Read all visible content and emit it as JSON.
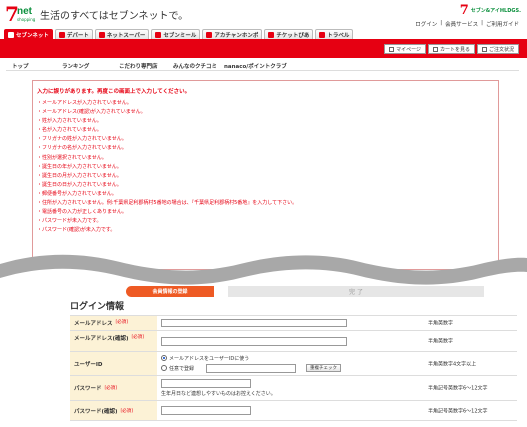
{
  "header": {
    "logo_main": "7",
    "logo_net": "net",
    "logo_sub": "shopping",
    "tagline": "生活のすべてはセブンネットで。",
    "brand_mark": "7",
    "brand_name": "セブン&アイHLDGS.",
    "util_links": [
      "ログイン",
      "|",
      "会員サービス",
      "|",
      "ご利用ガイド"
    ]
  },
  "tabs": [
    {
      "label": "セブンネット",
      "icon": "seven-net-icon"
    },
    {
      "label": "デパート",
      "icon": "department-store-icon"
    },
    {
      "label": "ネットスーパー",
      "icon": "net-super-icon"
    },
    {
      "label": "セブンミール",
      "icon": "seven-meal-icon"
    },
    {
      "label": "アカチャンホンポ",
      "icon": "akachan-honpo-icon"
    },
    {
      "label": "チケットぴあ",
      "icon": "ticket-pia-icon"
    },
    {
      "label": "トラベル",
      "icon": "travel-icon"
    }
  ],
  "account_buttons": [
    {
      "label": "マイページ",
      "icon": "person-icon"
    },
    {
      "label": "カートを見る",
      "icon": "cart-icon"
    },
    {
      "label": "ご注文状況",
      "icon": "document-icon"
    }
  ],
  "subnav": [
    "トップ",
    "ランキング",
    "こだわり専門店",
    "みんなのクチコミ",
    "nanaco/ポイントクラブ"
  ],
  "errors": {
    "title": "入力に誤りがあります。再度この画面上で入力してください。",
    "lines": [
      "・メールアドレスが入力されていません。",
      "・メールアドレス(確認)が入力されていません。",
      "・姓が入力されていません。",
      "・名が入力されていません。",
      "・フリガナの姓が入力されていません。",
      "・フリガナの名が入力されていません。",
      "・性別が選択されていません。",
      "・誕生日の年が入力されていません。",
      "・誕生日の月が入力されていません。",
      "・誕生日の日が入力されていません。",
      "・郵便番号が入力されていません。",
      "・住所が入力されていません。例:千葉県足利郡柄村5番地の場合は、『千葉県足利郡柄村5番地』を入力して下さい。",
      "・電話番号の入力が正しくありません。",
      "・パスワードが未入力です。",
      "・パスワード(確認)が未入力です。"
    ]
  },
  "steps": {
    "active": "会員情報の登録",
    "next": "完 了"
  },
  "form": {
    "title": "ログイン情報",
    "required": "[必須]",
    "rows": [
      {
        "label": "メールアドレス",
        "hint": "半角英数字"
      },
      {
        "label": "メールアドレス(確認)",
        "hint": "半角英数字"
      },
      {
        "label": "ユーザーID",
        "hint": "半角英数字4文字以上",
        "radio_use_email": "メールアドレスをユーザーIDに使う",
        "radio_custom": "任意で登録",
        "dup_check": "重複チェック"
      },
      {
        "label": "パスワード",
        "hint": "半角記号英数字6〜12文字",
        "note": "生年月日など連想しやすいものはお控えください。"
      },
      {
        "label": "パスワード(確認)",
        "hint": "半角記号英数字6〜12文字"
      }
    ]
  },
  "colors": {
    "brand_red": "#e60012",
    "brand_green": "#0a8f3c",
    "step_orange": "#ee5a24",
    "label_bg": "#fcf2d6"
  }
}
